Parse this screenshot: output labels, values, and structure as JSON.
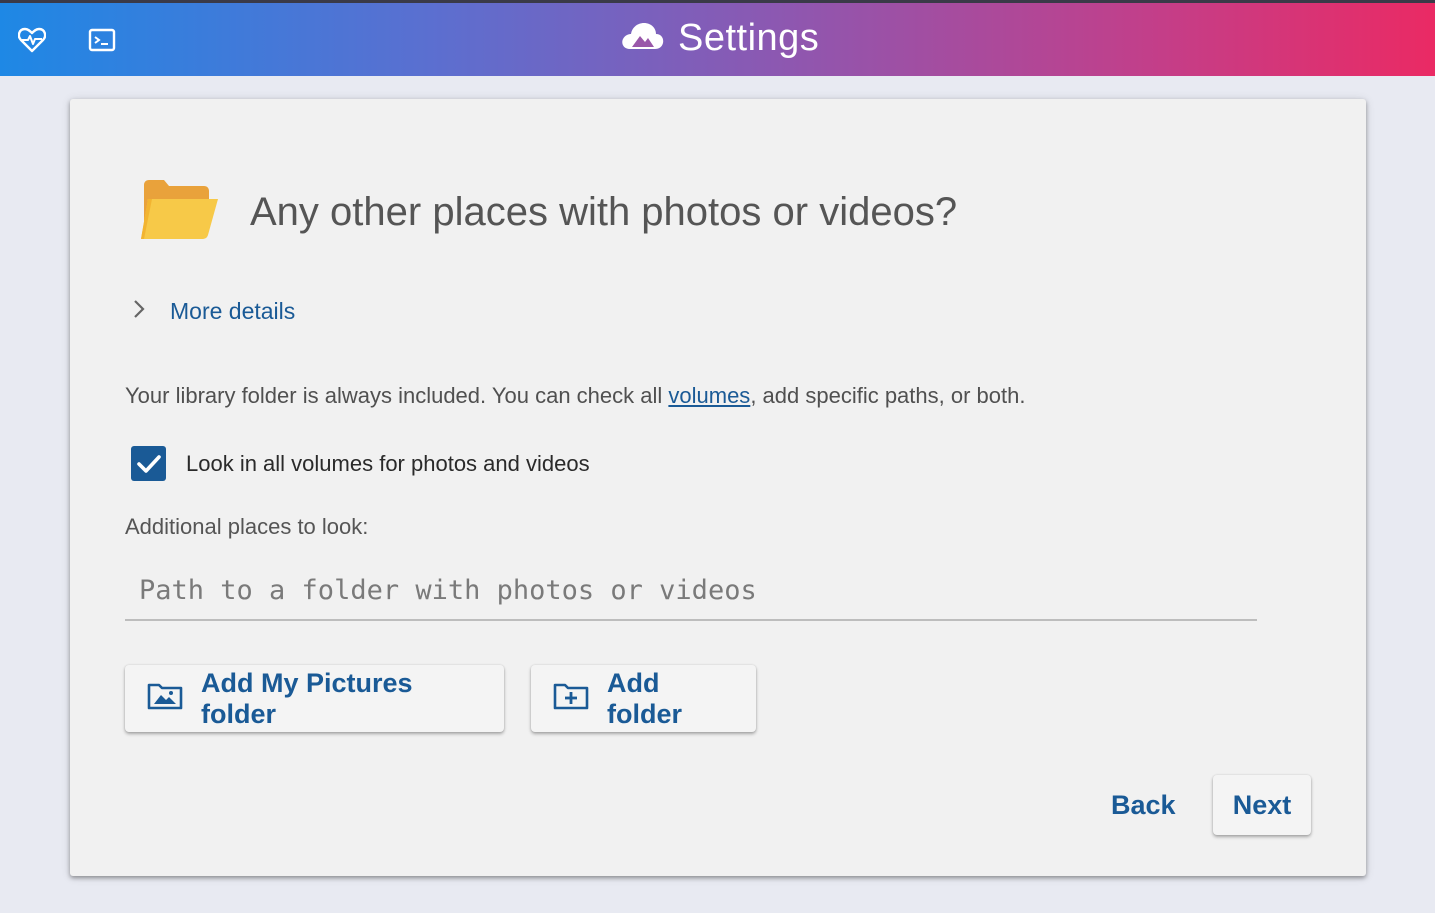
{
  "header": {
    "title": "Settings",
    "left_icons": [
      "heart-pulse-icon",
      "terminal-icon"
    ],
    "title_icon": "cloud-mountain-icon"
  },
  "main": {
    "heading": "Any other places with photos or videos?",
    "heading_icon": "open-folder-icon",
    "more_details": "More details",
    "info": {
      "before_link": "Your library folder is always included. You can check all ",
      "link": "volumes",
      "after_link": ", add specific paths, or both."
    },
    "checkbox": {
      "label": "Look in all volumes for photos and videos",
      "checked": true
    },
    "additional_label": "Additional places to look:",
    "path_input": {
      "value": "",
      "placeholder": "Path to a folder with photos or videos"
    },
    "buttons": {
      "add_pictures": "Add My Pictures folder",
      "add_folder": "Add folder"
    }
  },
  "footer": {
    "back": "Back",
    "next": "Next"
  },
  "colors": {
    "accent": "#1a5a96",
    "gradient_start": "#1e88e5",
    "gradient_end": "#ea2a64",
    "folder_yellow": "#f5b731"
  }
}
